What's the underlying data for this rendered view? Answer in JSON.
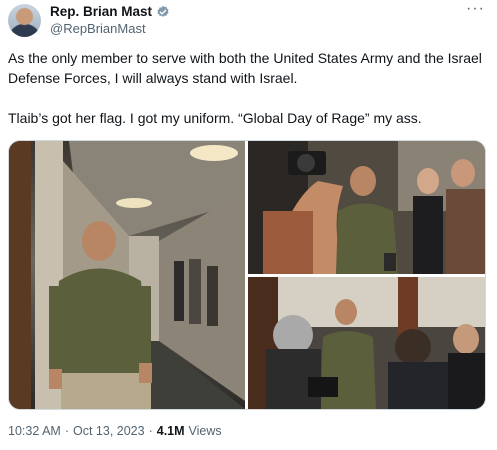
{
  "author": {
    "display_name": "Rep. Brian Mast",
    "handle": "@RepBrianMast",
    "verified_color": "#829aab"
  },
  "tweet": {
    "paragraph1": "As the only member to serve with both the United States Army and the Israel Defense Forces, I will always stand with Israel.",
    "paragraph2": "Tlaib’s got her flag. I got my uniform. “Global Day of Rage” my ass."
  },
  "meta": {
    "time": "10:32 AM",
    "separator": "·",
    "date": "Oct 13, 2023",
    "views_count": "4.1M",
    "views_label": "Views"
  },
  "menu": {
    "more_label": "···"
  },
  "media": {
    "photos": [
      {
        "label": "man-in-uniform-hallway-photo"
      },
      {
        "label": "press-photographers-photo"
      },
      {
        "label": "reporters-interview-photo"
      }
    ]
  }
}
